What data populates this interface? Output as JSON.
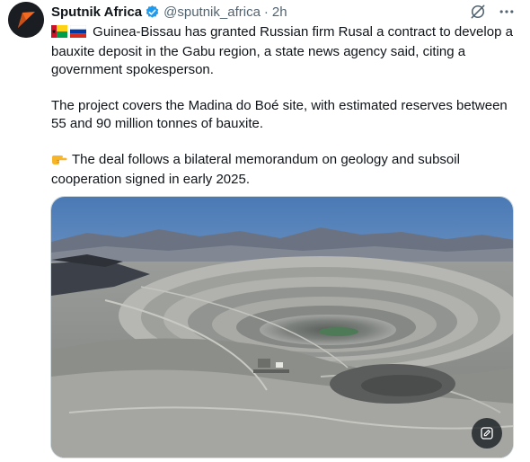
{
  "author": {
    "name": "Sputnik Africa",
    "handle": "@sputnik_africa",
    "separator": "·",
    "time": "2h",
    "verified_color": "#1d9bf0"
  },
  "icons": {
    "grok": "slashed-circle-icon",
    "more": "more-dots-icon",
    "flags": [
      "guinea-bissau-flag-icon",
      "russia-flag-icon"
    ],
    "pointing": "pointing-hand-icon",
    "media_action": "edit-image-icon"
  },
  "tweet": {
    "para1": "Guinea-Bissau has granted Russian firm Rusal a contract to develop a bauxite deposit in the Gabu region, a state news agency said, citing a government spokesperson.",
    "para2": "The project covers the Madina do Boé site, with estimated reserves between 55 and 90 million tonnes of bauxite.",
    "para3": "The deal follows a bilateral memorandum on geology and subsoil cooperation signed in early 2025."
  },
  "media": {
    "kind": "photo",
    "subject": "open-pit mine"
  },
  "colors": {
    "text": "#0f1419",
    "secondary": "#536471",
    "brand": "#f26a21"
  }
}
